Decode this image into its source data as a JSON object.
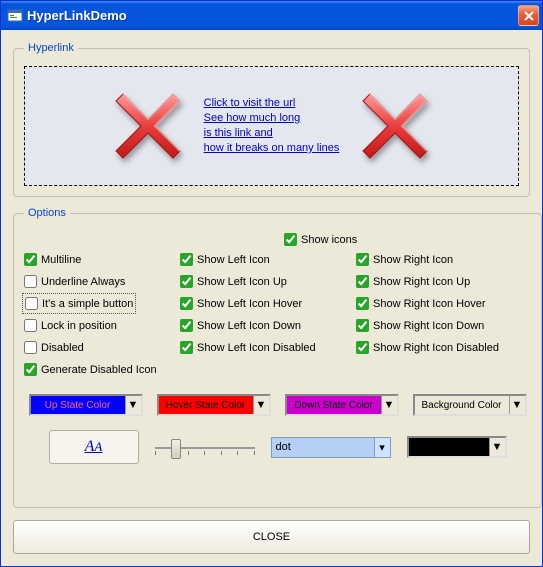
{
  "window": {
    "title": "HyperLinkDemo"
  },
  "hyperlink": {
    "legend": "Hyperlink",
    "line1": "Click to visit the url",
    "line2": "See how much long",
    "line3": "is this link and",
    "line4": "how it breaks on many lines"
  },
  "options": {
    "legend": "Options",
    "show_icons": "Show icons",
    "col1": {
      "multiline": "Multiline",
      "underline": "Underline Always",
      "simplebtn": "It's a simple button",
      "lockpos": "Lock in position",
      "disabled": "Disabled",
      "gendisabled": "Generate Disabled Icon"
    },
    "col2": {
      "left": "Show Left Icon",
      "leftup": "Show Left Icon Up",
      "lefthover": "Show Left Icon Hover",
      "leftdown": "Show Left Icon Down",
      "leftdisabled": "Show Left Icon Disabled"
    },
    "col3": {
      "right": "Show Right Icon",
      "rightup": "Show Right Icon Up",
      "righthover": "Show Right Icon Hover",
      "rightdown": "Show Right Icon Down",
      "rightdisabled": "Show Right Icon Disabled"
    },
    "colors": {
      "up": "Up State Color",
      "hover": "Hover State Color",
      "down": "Down State Color",
      "bg": "Background Color"
    },
    "font_btn": "A",
    "combo_value": "dot"
  },
  "close_label": "CLOSE"
}
